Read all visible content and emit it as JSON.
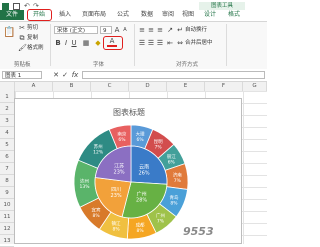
{
  "tabs": [
    {
      "label": "文件"
    },
    {
      "label": "开始"
    },
    {
      "label": "插入"
    },
    {
      "label": "页面布局"
    },
    {
      "label": "公式"
    },
    {
      "label": "数据"
    },
    {
      "label": "审阅"
    },
    {
      "label": "视图"
    },
    {
      "label": "设计"
    },
    {
      "label": "格式"
    }
  ],
  "chart_tools_label": "图表工具",
  "clipboard": {
    "cut": "剪切",
    "copy": "复制",
    "format_painter": "格式刷",
    "group_label": "剪贴板"
  },
  "font": {
    "name": "宋体 (正文)",
    "size": "9",
    "grow": "A",
    "shrink": "A",
    "group_label": "字体"
  },
  "alignment": {
    "wrap_text": "自动换行",
    "merge_center": "合并后居中",
    "group_label": "对齐方式"
  },
  "formula_bar": {
    "name_box": "图表 1",
    "fx": "fx"
  },
  "columns": [
    "A",
    "B",
    "C",
    "D",
    "E",
    "F",
    "G"
  ],
  "rows": [
    "1",
    "2",
    "3",
    "4",
    "5",
    "6",
    "7",
    "8",
    "9",
    "10",
    "11",
    "12",
    "13"
  ],
  "chart_data": {
    "type": "pie",
    "title": "图表标题",
    "inner_ring": [
      {
        "label": "云南",
        "percent": "26%",
        "value": 26,
        "color": "#3a7bc8"
      },
      {
        "label": "广州",
        "percent": "28%",
        "value": 28,
        "color": "#67b144"
      },
      {
        "label": "四川",
        "percent": "23%",
        "value": 23,
        "color": "#f2a13a"
      },
      {
        "label": "江苏",
        "percent": "23%",
        "value": 23,
        "color": "#8b6fc2"
      }
    ],
    "outer_ring": [
      {
        "label": "大理",
        "percent": "6%",
        "value": 6,
        "color": "#5a9ad8"
      },
      {
        "label": "昆明",
        "percent": "7%",
        "value": 7,
        "color": "#d24d4d"
      },
      {
        "label": "丽江",
        "percent": "6%",
        "value": 6,
        "color": "#43a09a"
      },
      {
        "label": "济南",
        "percent": "7%",
        "value": 7,
        "color": "#e07a3a"
      },
      {
        "label": "青岛",
        "percent": "8%",
        "value": 8,
        "color": "#4aa0d8"
      },
      {
        "label": "广州",
        "percent": "7%",
        "value": 7,
        "color": "#9fc24a"
      },
      {
        "label": "成都",
        "percent": "8%",
        "value": 8,
        "color": "#f5a623"
      },
      {
        "label": "镇江",
        "percent": "8%",
        "value": 8,
        "color": "#f0c040"
      },
      {
        "label": "宜宾",
        "percent": "8%",
        "value": 8,
        "color": "#d87a2a"
      },
      {
        "label": "达州",
        "percent": "13%",
        "value": 13,
        "color": "#5ab46a"
      },
      {
        "label": "苏州",
        "percent": "12%",
        "value": 12,
        "color": "#2e8b84"
      },
      {
        "label": "南京",
        "percent": "6%",
        "value": 6,
        "color": "#e86060"
      }
    ]
  },
  "watermark": "9553"
}
